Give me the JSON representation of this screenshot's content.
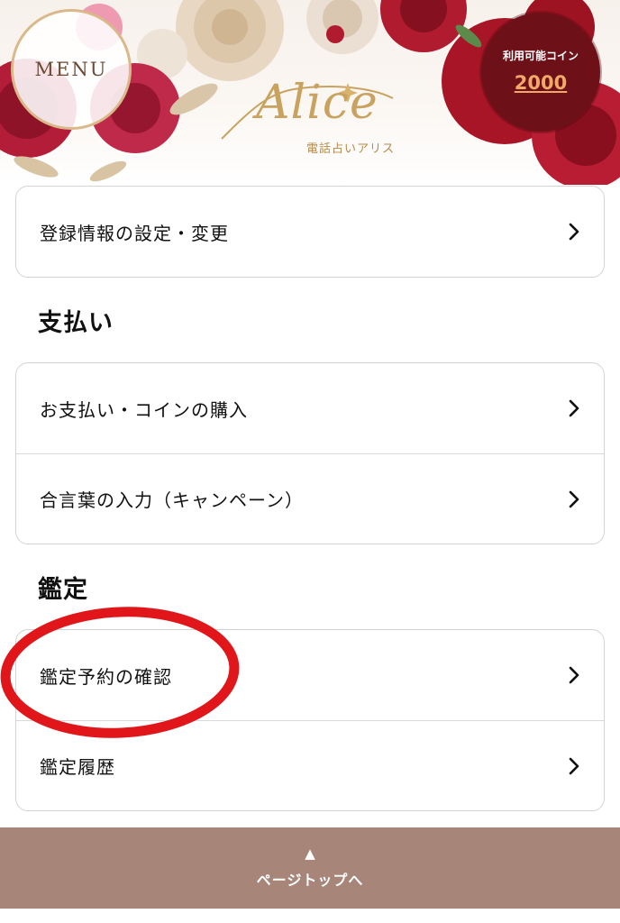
{
  "header": {
    "menu_label": "MENU",
    "logo_text": "Alice",
    "logo_subtitle": "電話占いアリス",
    "coin_label": "利用可能コイン",
    "coin_value": "2000"
  },
  "account": {
    "items": [
      {
        "label": "登録情報の設定・変更"
      }
    ]
  },
  "payment": {
    "title": "支払い",
    "items": [
      {
        "label": "お支払い・コインの購入"
      },
      {
        "label": "合言葉の入力（キャンペーン）"
      }
    ]
  },
  "reading": {
    "title": "鑑定",
    "items": [
      {
        "label": "鑑定予約の確認"
      },
      {
        "label": "鑑定履歴"
      }
    ]
  },
  "footer": {
    "arrow": "▲",
    "label": "ページトップへ"
  },
  "colors": {
    "footer_bg": "#a88579",
    "coin_badge_bg": "#6e1018",
    "coin_value": "#f0a968",
    "annotation_circle": "#e0161b"
  },
  "icons": [
    "chevron-right-icon",
    "floral-decoration",
    "annotation-circle"
  ]
}
